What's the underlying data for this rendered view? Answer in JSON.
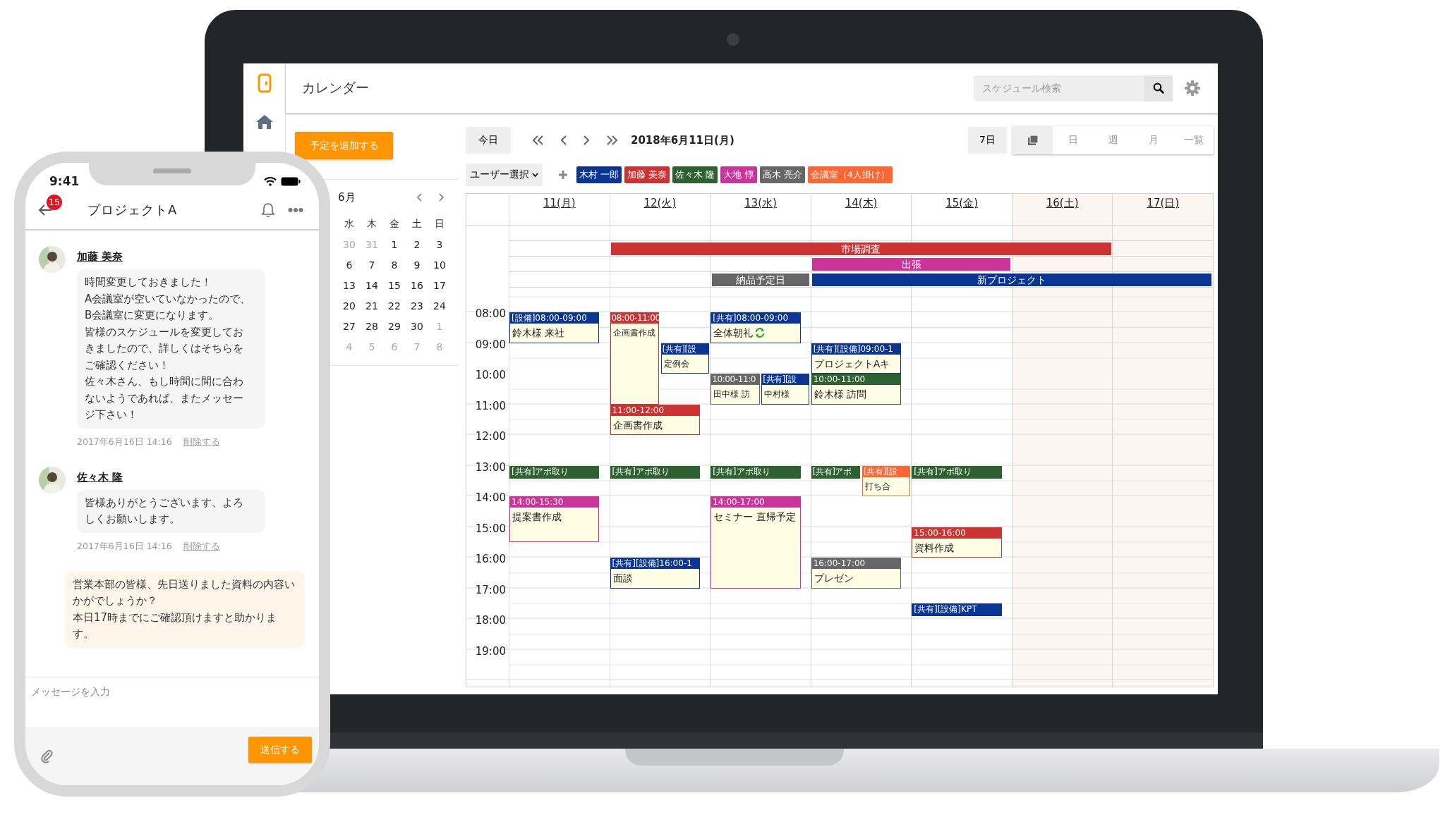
{
  "calendar_app": {
    "title": "カレンダー",
    "search": {
      "placeholder": "スケジュール検索"
    },
    "add_button": "予定を追加する",
    "mini_calendar": {
      "month": "6月",
      "weekdays": [
        "水",
        "木",
        "金",
        "土",
        "日"
      ],
      "weeks": [
        [
          {
            "day": "30",
            "muted": true
          },
          {
            "day": "31",
            "muted": true
          },
          {
            "day": "1",
            "muted": false
          },
          {
            "day": "2",
            "muted": false
          },
          {
            "day": "3",
            "muted": false
          }
        ],
        [
          {
            "day": "6",
            "muted": false
          },
          {
            "day": "7",
            "muted": false
          },
          {
            "day": "8",
            "muted": false
          },
          {
            "day": "9",
            "muted": false
          },
          {
            "day": "10",
            "muted": false
          }
        ],
        [
          {
            "day": "13",
            "muted": false
          },
          {
            "day": "14",
            "muted": false
          },
          {
            "day": "15",
            "muted": false
          },
          {
            "day": "16",
            "muted": false
          },
          {
            "day": "17",
            "muted": false
          }
        ],
        [
          {
            "day": "20",
            "muted": false
          },
          {
            "day": "21",
            "muted": false
          },
          {
            "day": "22",
            "muted": false
          },
          {
            "day": "23",
            "muted": false
          },
          {
            "day": "24",
            "muted": false
          }
        ],
        [
          {
            "day": "27",
            "muted": false
          },
          {
            "day": "28",
            "muted": false
          },
          {
            "day": "29",
            "muted": false
          },
          {
            "day": "30",
            "muted": false
          },
          {
            "day": "1",
            "muted": true
          }
        ],
        [
          {
            "day": "4",
            "muted": true
          },
          {
            "day": "5",
            "muted": true
          },
          {
            "day": "6",
            "muted": true
          },
          {
            "day": "7",
            "muted": true
          },
          {
            "day": "8",
            "muted": true
          }
        ]
      ]
    },
    "toolbar": {
      "today": "今日",
      "date": "2018年6月11日(月)",
      "range": "7日",
      "views": [
        {
          "kind": "icon",
          "selected": true
        },
        {
          "kind": "text",
          "label": "日",
          "selected": false
        },
        {
          "kind": "text",
          "label": "週",
          "selected": false
        },
        {
          "kind": "text",
          "label": "月",
          "selected": false
        },
        {
          "kind": "text",
          "label": "一覧",
          "selected": false
        }
      ]
    },
    "user_select": "ユーザー選択",
    "users": [
      {
        "name": "木村 一郎",
        "color": "#0a3592"
      },
      {
        "name": "加藤 美奈",
        "color": "#cc3333"
      },
      {
        "name": "佐々木 隆",
        "color": "#2e6130"
      },
      {
        "name": "大地 惇",
        "color": "#cc3399"
      },
      {
        "name": "高木 亮介",
        "color": "#666666"
      },
      {
        "name": "会議室（4人掛け）",
        "color": "#ff6633"
      }
    ],
    "all_day_rows": [
      [
        {
          "kind": "empty"
        },
        {
          "kind": "start",
          "title": "市場調査",
          "color": "#cc3333"
        },
        {
          "kind": "more"
        },
        {
          "kind": "more"
        },
        {
          "kind": "more"
        },
        {
          "kind": "more"
        },
        {
          "kind": "empty"
        }
      ],
      [
        {
          "kind": "empty"
        },
        {
          "kind": "empty"
        },
        {
          "kind": "empty"
        },
        {
          "kind": "start",
          "title": "出張",
          "color": "#cc3399"
        },
        {
          "kind": "more"
        },
        {
          "kind": "empty"
        },
        {
          "kind": "empty"
        }
      ],
      [
        {
          "kind": "empty"
        },
        {
          "kind": "empty"
        },
        {
          "kind": "start",
          "title": "納品予定日",
          "color": "#666666"
        },
        {
          "kind": "start",
          "title": "新プロジェクト",
          "color": "#0a3592"
        },
        {
          "kind": "more"
        },
        {
          "kind": "more"
        },
        {
          "kind": "more"
        }
      ]
    ],
    "hours": [
      "08:00",
      "09:00",
      "10:00",
      "11:00",
      "12:00",
      "13:00",
      "14:00",
      "15:00",
      "16:00",
      "17:00",
      "18:00",
      "19:00"
    ],
    "days": [
      {
        "label": "11(月)",
        "weekend": false,
        "slots": [
          {
            "kind": "busy",
            "events": [
              {
                "kind": "hour",
                "header": "[設備]08:00-09:00",
                "title": "鈴木様 来社",
                "color": "#0a3592"
              }
            ]
          },
          {
            "kind": "free"
          },
          {
            "kind": "free"
          },
          {
            "kind": "free"
          },
          {
            "kind": "free"
          },
          {
            "kind": "busy",
            "events": [
              {
                "kind": "bar",
                "header": "[共有]アポ取り",
                "color": "#2e6130"
              }
            ]
          },
          {
            "kind": "busy",
            "events": [
              {
                "kind": "ninety",
                "header": "14:00-15:30",
                "title": "提案書作成",
                "color": "#cc3399"
              }
            ]
          }
        ]
      },
      {
        "label": "12(火)",
        "weekend": false,
        "slots": [
          {
            "kind": "busy",
            "events": [
              {
                "kind": "three",
                "header": "08:00-11:00",
                "title": "企画書作成",
                "color": "#cc3333"
              }
            ]
          },
          {
            "kind": "busy",
            "events": [
              {
                "kind": "hour",
                "header": "[共有][設",
                "title": "定例会",
                "color": "#0a3592"
              }
            ]
          },
          {
            "kind": "free"
          },
          {
            "kind": "busy",
            "events": [
              {
                "kind": "hour",
                "header": "11:00-12:00",
                "title": "企画書作成",
                "color": "#cc3333"
              }
            ]
          },
          {
            "kind": "free"
          },
          {
            "kind": "busy",
            "events": [
              {
                "kind": "bar",
                "header": "[共有]アポ取り",
                "color": "#2e6130"
              }
            ]
          },
          {
            "kind": "free"
          },
          {
            "kind": "free"
          },
          {
            "kind": "busy",
            "events": [
              {
                "kind": "hour",
                "header": "[共有][設備]16:00-1",
                "title": "面談",
                "color": "#0a3592"
              }
            ]
          }
        ]
      },
      {
        "label": "13(水)",
        "weekend": false,
        "slots": [
          {
            "kind": "busy",
            "events": [
              {
                "kind": "hour",
                "header": "[共有]08:00-09:00",
                "title": "全体朝礼",
                "color": "#0a3592",
                "repeat": true
              }
            ]
          },
          {
            "kind": "free"
          },
          {
            "kind": "busy",
            "events": [
              {
                "kind": "hour",
                "header": "10:00-11:0",
                "title": "田中様 訪",
                "color": "#666666"
              },
              {
                "kind": "hour",
                "header": "[共有][設",
                "title": "中村様",
                "color": "#0a3592"
              }
            ]
          },
          {
            "kind": "free"
          },
          {
            "kind": "free"
          },
          {
            "kind": "busy",
            "events": [
              {
                "kind": "bar",
                "header": "[共有]アポ取り",
                "color": "#2e6130"
              }
            ]
          },
          {
            "kind": "busy",
            "events": [
              {
                "kind": "three",
                "header": "14:00-17:00",
                "title": "セミナー 直帰予定",
                "color": "#cc3399"
              }
            ]
          }
        ]
      },
      {
        "label": "14(木)",
        "weekend": false,
        "slots": [
          {
            "kind": "free"
          },
          {
            "kind": "busy",
            "events": [
              {
                "kind": "hour",
                "header": "[共有][設備]09:00-1",
                "title": "プロジェクトAキ",
                "color": "#0a3592"
              }
            ]
          },
          {
            "kind": "busy",
            "events": [
              {
                "kind": "hour",
                "header": "10:00-11:00",
                "title": "鈴木様 訪問",
                "color": "#2e6130"
              }
            ]
          },
          {
            "kind": "free"
          },
          {
            "kind": "free"
          },
          {
            "kind": "busy",
            "events": [
              {
                "kind": "bar",
                "header": "[共有]アポ",
                "color": "#2e6130"
              },
              {
                "kind": "hour",
                "header": "[共有][設",
                "title": "打ち合",
                "color": "#ff6633"
              }
            ]
          },
          {
            "kind": "free"
          },
          {
            "kind": "free"
          },
          {
            "kind": "busy",
            "events": [
              {
                "kind": "hour",
                "header": "16:00-17:00",
                "title": "プレゼン",
                "color": "#666666"
              }
            ]
          }
        ]
      },
      {
        "label": "15(金)",
        "weekend": false,
        "slots": [
          {
            "kind": "free"
          },
          {
            "kind": "free"
          },
          {
            "kind": "free"
          },
          {
            "kind": "free"
          },
          {
            "kind": "free"
          },
          {
            "kind": "busy",
            "events": [
              {
                "kind": "bar",
                "header": "[共有]アポ取り",
                "color": "#2e6130"
              }
            ]
          },
          {
            "kind": "free"
          },
          {
            "kind": "busy",
            "events": [
              {
                "kind": "hour",
                "header": "15:00-16:00",
                "title": "資料作成",
                "color": "#cc3333"
              }
            ]
          },
          {
            "kind": "free"
          },
          {
            "kind": "busy",
            "events": [
              {
                "kind": "late_bar",
                "header": "[共有][設備]KPT",
                "color": "#0a3592"
              }
            ]
          }
        ]
      },
      {
        "label": "16(土)",
        "weekend": true
      },
      {
        "label": "17(日)",
        "weekend": true
      }
    ]
  },
  "phone": {
    "status_time": "9:41",
    "header": {
      "title": "プロジェクトA",
      "badge": "15"
    },
    "messages": [
      {
        "kind": "other",
        "author": "加藤 美奈",
        "paragraphs": [
          "時間変更しておきました！",
          "A会議室が空いていなかったので、B会議室に変更になります。",
          "皆様のスケジュールを変更しておきましたので、詳しくはそちらをご確認ください！",
          "佐々木さん、もし時間に間に合わないようであれば、またメッセージ下さい！"
        ],
        "time": "2017年6月16日 14:16",
        "delete": "削除する"
      },
      {
        "kind": "other",
        "author": "佐々木 隆",
        "paragraphs": [
          "皆様ありがとうございます、よろしくお願いします。"
        ],
        "time": "2017年6月16日 14:16",
        "delete": "削除する"
      },
      {
        "kind": "own",
        "paragraphs": [
          "営業本部の皆様、先日送りました資料の内容いかがでしょうか？",
          "本日17時までにご確認頂けますと助かります。"
        ]
      }
    ],
    "input": {
      "placeholder": "メッセージを入力"
    },
    "send_button": "送信する"
  }
}
